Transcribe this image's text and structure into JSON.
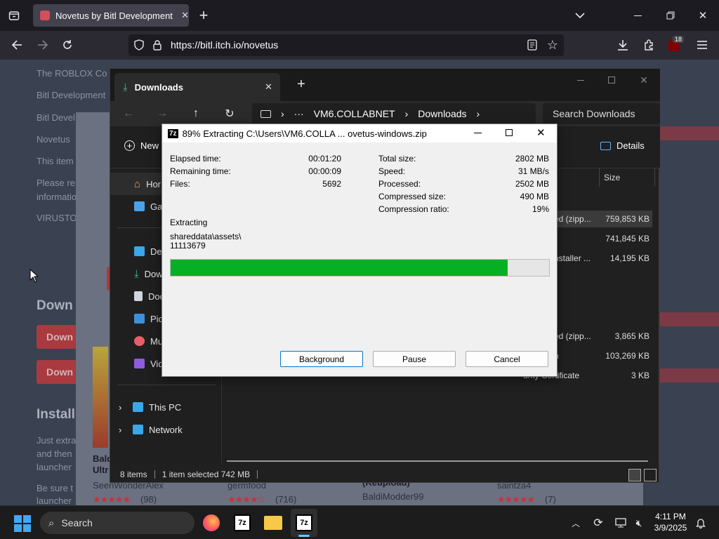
{
  "browser": {
    "tab_title": "Novetus by Bitl Development Studio",
    "url": "https://bitl.itch.io/novetus",
    "extensions_badge": "18"
  },
  "page": {
    "lines": [
      "The ROBLOX Co",
      "Bitl Development",
      "Bitl Devel",
      "Novetus",
      "This item",
      "Please re",
      "informatio",
      "VIRUSTO"
    ],
    "download_heading": "Down",
    "download_btn1": "Down",
    "download_btn2": "Down",
    "install_heading": "Install",
    "install_text": [
      "Just extra",
      "and then",
      "launcher"
    ],
    "be_sure": [
      "Be sure t",
      "launcher"
    ],
    "cards": [
      {
        "title1": "Bald",
        "title2": "Ultr",
        "author": "SeenWonderAlex",
        "stars": "★★★★★",
        "count": "(98)"
      },
      {
        "title1": "",
        "title2": "",
        "author": "germfood",
        "stars": "★★★★☆",
        "count": "(716)"
      },
      {
        "title1": "(Reupload)",
        "title2": "",
        "author": "BaldiModder99",
        "stars": "",
        "count": ""
      },
      {
        "title1": "",
        "title2": "",
        "author": "saintza4",
        "stars": "★★★★★",
        "count": "(7)"
      }
    ]
  },
  "explorer": {
    "tab_title": "Downloads",
    "breadcrumb": [
      "VM6.COLLABNET",
      "Downloads"
    ],
    "search_placeholder": "Search Downloads",
    "new_label": "New",
    "details_label": "Details",
    "size_header": "Size",
    "sidebar": [
      "Home",
      "Gallery",
      "Desktop",
      "Downloads",
      "Documents",
      "Pictures",
      "Music",
      "Videos"
    ],
    "sidebar_visible": [
      "Hor",
      "Gall",
      "Des",
      "Dow",
      "Doc",
      "Pict",
      "Mu",
      "Vid"
    ],
    "tree": [
      "This PC",
      "Network"
    ],
    "files": [
      {
        "type": "ed (zipp...",
        "size": "759,853 KB"
      },
      {
        "type": "",
        "size": "741,845 KB"
      },
      {
        "type": "nstaller ...",
        "size": "14,195 KB"
      },
      {
        "type": "ed (zipp...",
        "size": "3,865 KB"
      },
      {
        "type": "n",
        "size": "103,269 KB"
      },
      {
        "type": "urity Certificate",
        "size": "3 KB"
      }
    ],
    "status_items": "8 items",
    "status_selected": "1 item selected  742 MB"
  },
  "dialog": {
    "icon_text": "7z",
    "title": "89% Extracting C:\\Users\\VM6.COLLA ... ovetus-windows.zip",
    "left_labels": [
      "Elapsed time:",
      "Remaining time:",
      "Files:"
    ],
    "left_values": [
      "00:01:20",
      "00:00:09",
      "5692"
    ],
    "right_labels": [
      "Total size:",
      "Speed:",
      "Processed:",
      "Compressed size:",
      "Compression ratio:"
    ],
    "right_values": [
      "2802 MB",
      "31 MB/s",
      "2502 MB",
      "490 MB",
      "19%"
    ],
    "extracting_label": "Extracting",
    "path_line1": "shareddata\\assets\\",
    "path_line2": "11113679",
    "progress": 0.89,
    "progress_color": "#06b025",
    "buttons": {
      "background": "Background",
      "pause": "Pause",
      "cancel": "Cancel"
    }
  },
  "taskbar": {
    "search_label": "Search",
    "time": "4:11 PM",
    "date": "3/9/2025",
    "apps": [
      "firefox-icon",
      "7zip-icon",
      "file-explorer-icon",
      "7zip-active-icon"
    ]
  }
}
